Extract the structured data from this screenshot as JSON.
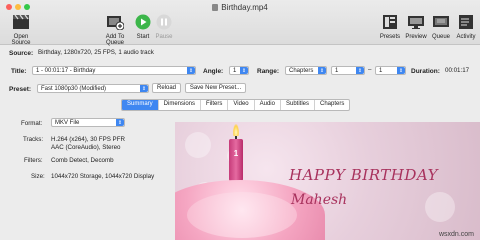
{
  "window": {
    "title": "Birthday.mp4"
  },
  "toolbar": {
    "open_source": "Open Source",
    "add_to_queue": "Add To Queue",
    "start": "Start",
    "pause": "Pause",
    "presets": "Presets",
    "preview": "Preview",
    "queue": "Queue",
    "activity": "Activity"
  },
  "source": {
    "label": "Source:",
    "value": "Birthday, 1280x720, 25 FPS, 1 audio track"
  },
  "title_row": {
    "label": "Title:",
    "value": "1 - 00:01:17 - Birthday",
    "angle_label": "Angle:",
    "angle_value": "1",
    "range_label": "Range:",
    "range_type": "Chapters",
    "range_from": "1",
    "range_sep": "–",
    "range_to": "1",
    "duration_label": "Duration:",
    "duration_value": "00:01:17"
  },
  "preset_row": {
    "label": "Preset:",
    "value": "Fast 1080p30 (Modified)",
    "reload": "Reload",
    "save_new": "Save New Preset..."
  },
  "tabs": [
    "Summary",
    "Dimensions",
    "Filters",
    "Video",
    "Audio",
    "Subtitles",
    "Chapters"
  ],
  "summary": {
    "format_label": "Format:",
    "format_value": "MKV File",
    "tracks_label": "Tracks:",
    "tracks_line1": "H.264 (x264), 30 FPS PFR",
    "tracks_line2": "AAC (CoreAudio), Stereo",
    "filters_label": "Filters:",
    "filters_value": "Comb Detect, Decomb",
    "size_label": "Size:",
    "size_value": "1044x720 Storage, 1044x720 Display"
  },
  "preview_image": {
    "line1": "HAPPY BIRTHDAY",
    "line2": "Mahesh",
    "candle_number": "1"
  },
  "watermark": "wsxdn.com",
  "colors": {
    "accent": "#3f87f1",
    "start_green": "#3cb64a",
    "card_pink": "#a8325d"
  }
}
